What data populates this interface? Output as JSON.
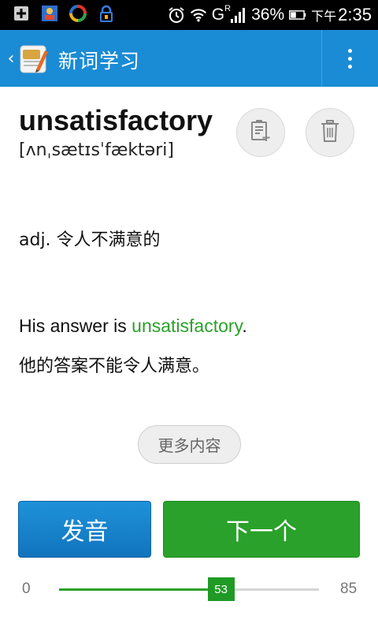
{
  "status_bar": {
    "network_label": "G",
    "network_sup": "R",
    "battery": "36%",
    "time_period": "下午",
    "time": "2:35"
  },
  "action_bar": {
    "title": "新词学习"
  },
  "word": {
    "text": "unsatisfactory",
    "phonetic": "[ʌnˌsætɪsˈfæktəri]",
    "definition": "adj. 令人不满意的"
  },
  "example": {
    "en_prefix": "His answer is ",
    "en_highlight": "unsatisfactory",
    "en_suffix": ".",
    "zh": "他的答案不能令人满意。"
  },
  "buttons": {
    "more": "更多内容",
    "pronounce": "发音",
    "next": "下一个"
  },
  "progress": {
    "min": "0",
    "max": "85",
    "current": "53",
    "fraction": 0.623
  },
  "colors": {
    "action_bar": "#1a8bd5",
    "accent_green": "#2aa12a",
    "pronounce_blue": "#1a84cc"
  },
  "icons": {
    "status": [
      "image-icon",
      "gallery-icon",
      "sync-icon",
      "lock-icon",
      "alarm-icon",
      "wifi-icon",
      "signal-icon",
      "battery-icon"
    ],
    "add_to_list": "add-to-list-icon",
    "delete": "trash-icon",
    "menu": "overflow-menu-icon",
    "back": "chevron-left-icon"
  }
}
